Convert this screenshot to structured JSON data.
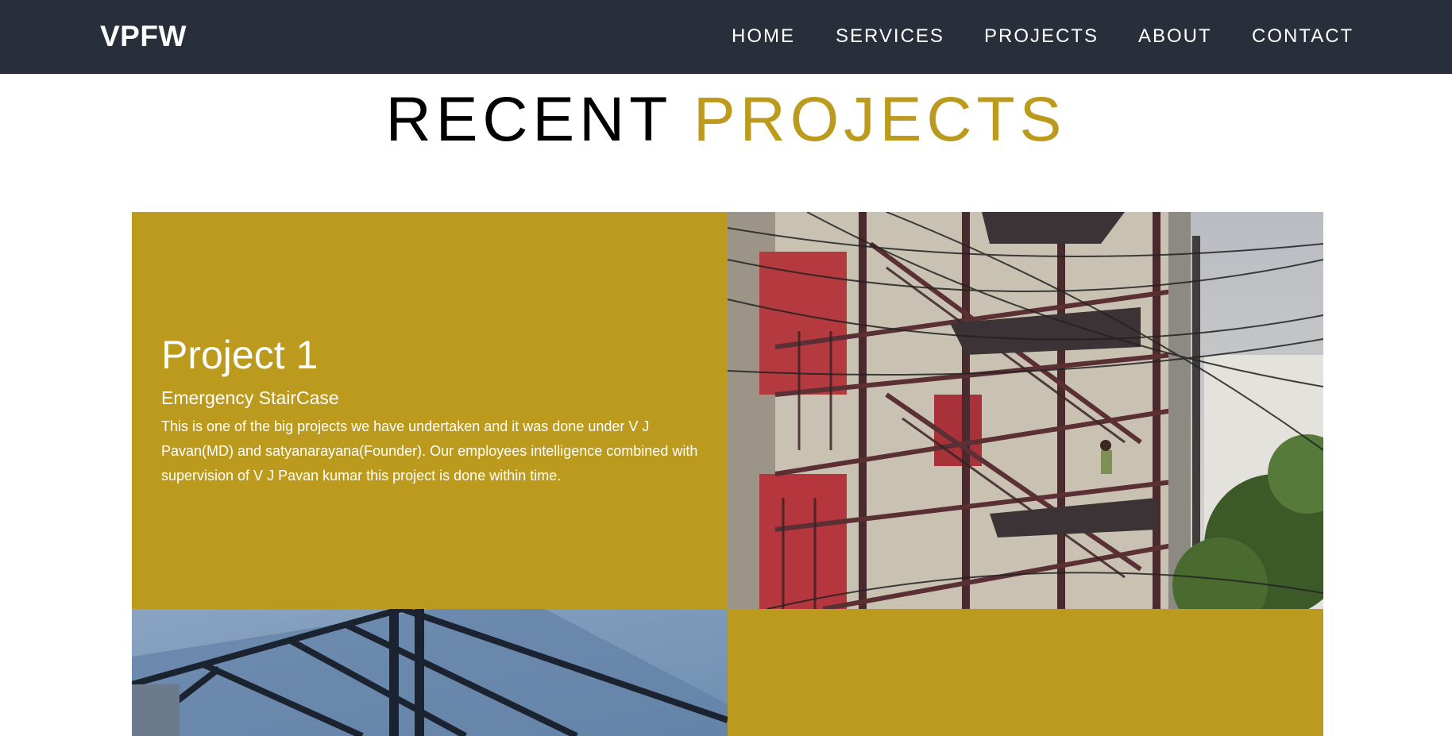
{
  "nav": {
    "brand": "VPFW",
    "links": [
      {
        "label": "HOME"
      },
      {
        "label": "SERVICES"
      },
      {
        "label": "PROJECTS"
      },
      {
        "label": "ABOUT"
      },
      {
        "label": "CONTACT"
      }
    ]
  },
  "section": {
    "title_dark": "RECENT",
    "title_accent": "PROJECTS"
  },
  "projects": [
    {
      "title": "Project 1",
      "subtitle": "Emergency StairCase",
      "description": "This is one of the big projects we have undertaken and it was done under V J Pavan(MD) and satyanarayana(Founder). Our employees intelligence combined with supervision of V J Pavan kumar this project is done within time.",
      "image": "emergency-staircase-photo"
    },
    {
      "image": "roof-structure-photo"
    }
  ],
  "colors": {
    "navbar": "#282f3b",
    "accent": "#bb9a1e",
    "text_light": "#ffffff",
    "text_dark": "#000000"
  }
}
